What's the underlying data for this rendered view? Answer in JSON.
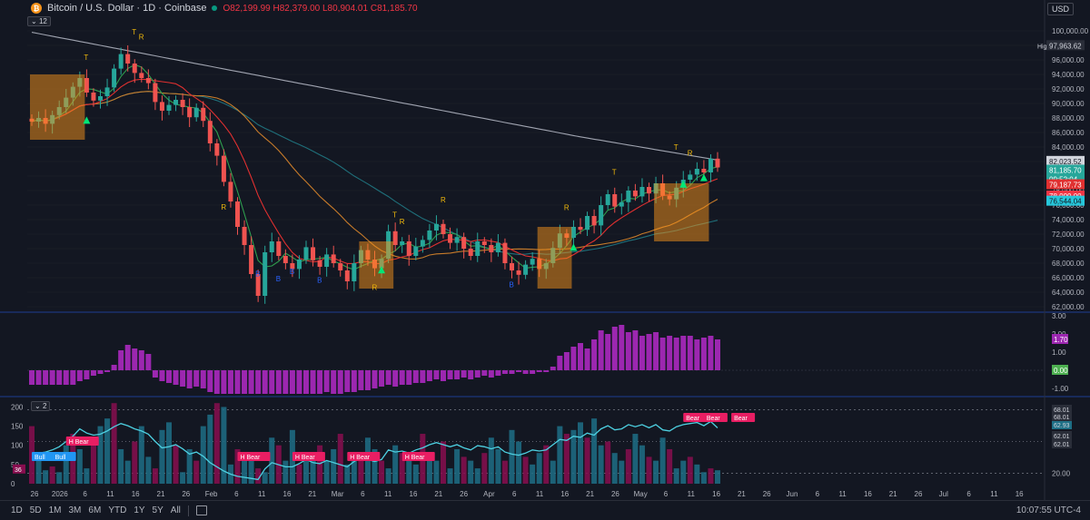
{
  "header": {
    "symbol": "Bitcoin / U.S. Dollar · 1D · Coinbase",
    "coin_glyph": "₿",
    "ohlc": {
      "o": "O82,199.99",
      "h": "H82,379.00",
      "l": "L80,904.01",
      "c": "C81,185.70"
    },
    "currency": "USD",
    "pane1_badge": "12",
    "pane3_badge": "2"
  },
  "footer": {
    "timeframes": [
      "1D",
      "5D",
      "1M",
      "3M",
      "6M",
      "YTD",
      "1Y",
      "5Y",
      "All"
    ],
    "clock": "10:07:55 UTC-4"
  },
  "colors": {
    "up": "#089981",
    "down": "#f23645",
    "bg": "#131722",
    "grid": "#2a2e39",
    "text": "#b2b5be",
    "purple": "#9c27b0",
    "orange": "#f7931a"
  },
  "chart_data": [
    {
      "type": "candlestick",
      "title": "Bitcoin / U.S. Dollar · 1D · Coinbase",
      "x_axis": {
        "labels": [
          "26",
          "2026",
          "6",
          "11",
          "16",
          "21",
          "26",
          "Feb",
          "6",
          "11",
          "16",
          "21",
          "Mar",
          "6",
          "11",
          "16",
          "21",
          "26",
          "Apr",
          "6",
          "11",
          "16",
          "21",
          "26",
          "May",
          "6",
          "11",
          "16",
          "21",
          "26",
          "Jun",
          "6",
          "11",
          "16",
          "21",
          "26",
          "Jul",
          "6",
          "11",
          "16"
        ]
      },
      "y_ticks": [
        "100,000.00",
        "98,000.00",
        "96,000.00",
        "94,000.00",
        "92,000.00",
        "90,000.00",
        "88,000.00",
        "86,000.00",
        "84,000.00",
        "82,000.00",
        "80,000.00",
        "78,000.00",
        "76,000.00",
        "74,000.00",
        "72,000.00",
        "70,000.00",
        "68,000.00",
        "66,000.00",
        "64,000.00",
        "62,000.00"
      ],
      "ylim": [
        61500,
        101500
      ],
      "close_series": [
        87500,
        88000,
        87200,
        88400,
        89500,
        90800,
        92300,
        93500,
        91500,
        90400,
        91000,
        92200,
        94800,
        96800,
        95500,
        94200,
        93500,
        92800,
        90200,
        89000,
        89800,
        90500,
        89500,
        88100,
        89400,
        87600,
        84500,
        82800,
        79200,
        76500,
        73000,
        70500,
        66500,
        63500,
        69500,
        71000,
        69000,
        68000,
        67200,
        68500,
        70200,
        68400,
        67500,
        69200,
        68000,
        67000,
        65500,
        68000,
        69800,
        68500,
        67300,
        68600,
        72400,
        70500,
        71000,
        69000,
        70300,
        71200,
        72500,
        73400,
        72000,
        70800,
        71600,
        70000,
        69000,
        71000,
        70500,
        69500,
        70800,
        68000,
        67000,
        66400,
        67800,
        68600,
        67200,
        68000,
        70100,
        72100,
        71500,
        73000,
        72600,
        74500,
        73200,
        76000,
        77500,
        75800,
        76400,
        78000,
        77200,
        78500,
        77600,
        79000,
        77300,
        76800,
        78400,
        79500,
        80200,
        81000,
        80500,
        82400,
        81185.7
      ],
      "indicators": {
        "long_ma_label": "82,023.52",
        "short_ma_label": "79,187.73",
        "mid_ma_label": "76,544.04",
        "level_label": "78,000.00"
      },
      "price_labels": {
        "high_label": "High",
        "high_value": "97,963.62",
        "last": "81,185.70",
        "countdown": "09:52:04",
        "level": "78,000.00",
        "ma_long": "82,023.52",
        "ma_mid": "76,544.04",
        "ma_short": "79,187.73"
      },
      "signal_labels": [
        "T",
        "R",
        "B"
      ]
    },
    {
      "type": "bar",
      "y_ticks": [
        "3.00",
        "2.00",
        "1.00",
        "-1.00"
      ],
      "ylim": [
        -1.3,
        3.1
      ],
      "labels": {
        "value": "1.70",
        "zero": "0.00"
      },
      "values": [
        -0.8,
        -0.8,
        -0.8,
        -0.8,
        -0.8,
        -0.8,
        -0.8,
        -0.6,
        -0.5,
        -0.3,
        -0.2,
        -0.1,
        0.3,
        1.1,
        1.4,
        1.2,
        1.1,
        0.9,
        -0.4,
        -0.6,
        -0.7,
        -0.8,
        -0.9,
        -1.0,
        -0.9,
        -1.0,
        -1.2,
        -1.3,
        -1.3,
        -1.3,
        -1.3,
        -1.3,
        -1.3,
        -1.3,
        -1.3,
        -1.3,
        -1.3,
        -1.3,
        -1.3,
        -1.3,
        -1.3,
        -1.3,
        -1.3,
        -1.2,
        -1.3,
        -1.3,
        -1.2,
        -1.2,
        -1.1,
        -1.1,
        -1.0,
        -0.9,
        -0.8,
        -0.9,
        -0.8,
        -0.8,
        -0.7,
        -0.7,
        -0.6,
        -0.5,
        -0.6,
        -0.5,
        -0.5,
        -0.4,
        -0.5,
        -0.4,
        -0.3,
        -0.4,
        -0.3,
        -0.2,
        -0.2,
        -0.1,
        -0.2,
        -0.2,
        -0.1,
        -0.1,
        0.2,
        0.8,
        1.0,
        1.3,
        1.5,
        1.2,
        1.7,
        2.2,
        2.0,
        2.4,
        2.5,
        2.1,
        2.2,
        1.9,
        2.0,
        2.1,
        1.8,
        1.9,
        1.8,
        1.9,
        1.9,
        1.7,
        1.8,
        1.9,
        1.7
      ]
    },
    {
      "type": "bar+line",
      "y_ticks": [
        "200",
        "150",
        "100",
        "50",
        "0",
        "80.00",
        "20.00"
      ],
      "left_ylim": [
        0,
        220
      ],
      "right_ylim": [
        10,
        90
      ],
      "labels": {
        "rsi_high": "68.01",
        "rsi_val1": "62.93",
        "rsi_val2": "62.01",
        "rsi_val3": "68.01",
        "rsi_val4": "62.01",
        "left_val": "36"
      },
      "bar_values": [
        150,
        60,
        35,
        45,
        30,
        100,
        130,
        90,
        40,
        120,
        150,
        170,
        210,
        90,
        60,
        110,
        150,
        70,
        40,
        140,
        160,
        100,
        30,
        90,
        60,
        150,
        180,
        210,
        200,
        50,
        90,
        70,
        60,
        40,
        30,
        120,
        100,
        60,
        140,
        50,
        70,
        80,
        100,
        60,
        90,
        130,
        50,
        70,
        80,
        120,
        90,
        60,
        40,
        100,
        80,
        60,
        50,
        130,
        80,
        60,
        110,
        40,
        90,
        70,
        60,
        40,
        80,
        120,
        90,
        60,
        140,
        110,
        70,
        50,
        80,
        100,
        60,
        150,
        130,
        140,
        160,
        120,
        170,
        100,
        110,
        80,
        60,
        90,
        130,
        100,
        70,
        60,
        120,
        90,
        40,
        60,
        70,
        50,
        30,
        40,
        35
      ],
      "rsi_line": [
        38,
        39,
        40,
        42,
        45,
        50,
        55,
        62,
        58,
        56,
        57,
        60,
        64,
        67,
        65,
        62,
        60,
        57,
        50,
        44,
        45,
        47,
        43,
        38,
        40,
        36,
        30,
        26,
        22,
        19,
        17,
        16,
        15,
        14,
        24,
        30,
        28,
        26,
        26,
        29,
        33,
        30,
        29,
        32,
        30,
        28,
        26,
        31,
        35,
        33,
        31,
        33,
        42,
        40,
        41,
        39,
        42,
        44,
        47,
        49,
        47,
        45,
        47,
        44,
        42,
        46,
        45,
        43,
        45,
        40,
        38,
        37,
        39,
        42,
        41,
        42,
        47,
        52,
        51,
        55,
        54,
        58,
        56,
        62,
        65,
        61,
        62,
        66,
        64,
        66,
        63,
        66,
        61,
        60,
        64,
        66,
        67,
        68,
        65,
        69,
        62.93
      ],
      "signal_tags": [
        {
          "text": "H Bear",
          "index": 5,
          "fill": "#e91e63"
        },
        {
          "text": "Bull",
          "index": 0,
          "fill": "#2196f3"
        },
        {
          "text": "Bull",
          "index": 3,
          "fill": "#2196f3"
        },
        {
          "text": "H Bear",
          "index": 30,
          "fill": "#e91e63"
        },
        {
          "text": "H Bear",
          "index": 38,
          "fill": "#e91e63"
        },
        {
          "text": "H Bear",
          "index": 46,
          "fill": "#e91e63"
        },
        {
          "text": "H Bear",
          "index": 54,
          "fill": "#e91e63"
        },
        {
          "text": "Bear",
          "index": 95,
          "fill": "#e91e63"
        },
        {
          "text": "Bear",
          "index": 98,
          "fill": "#e91e63"
        },
        {
          "text": "Bear",
          "index": 102,
          "fill": "#e91e63"
        }
      ]
    }
  ]
}
